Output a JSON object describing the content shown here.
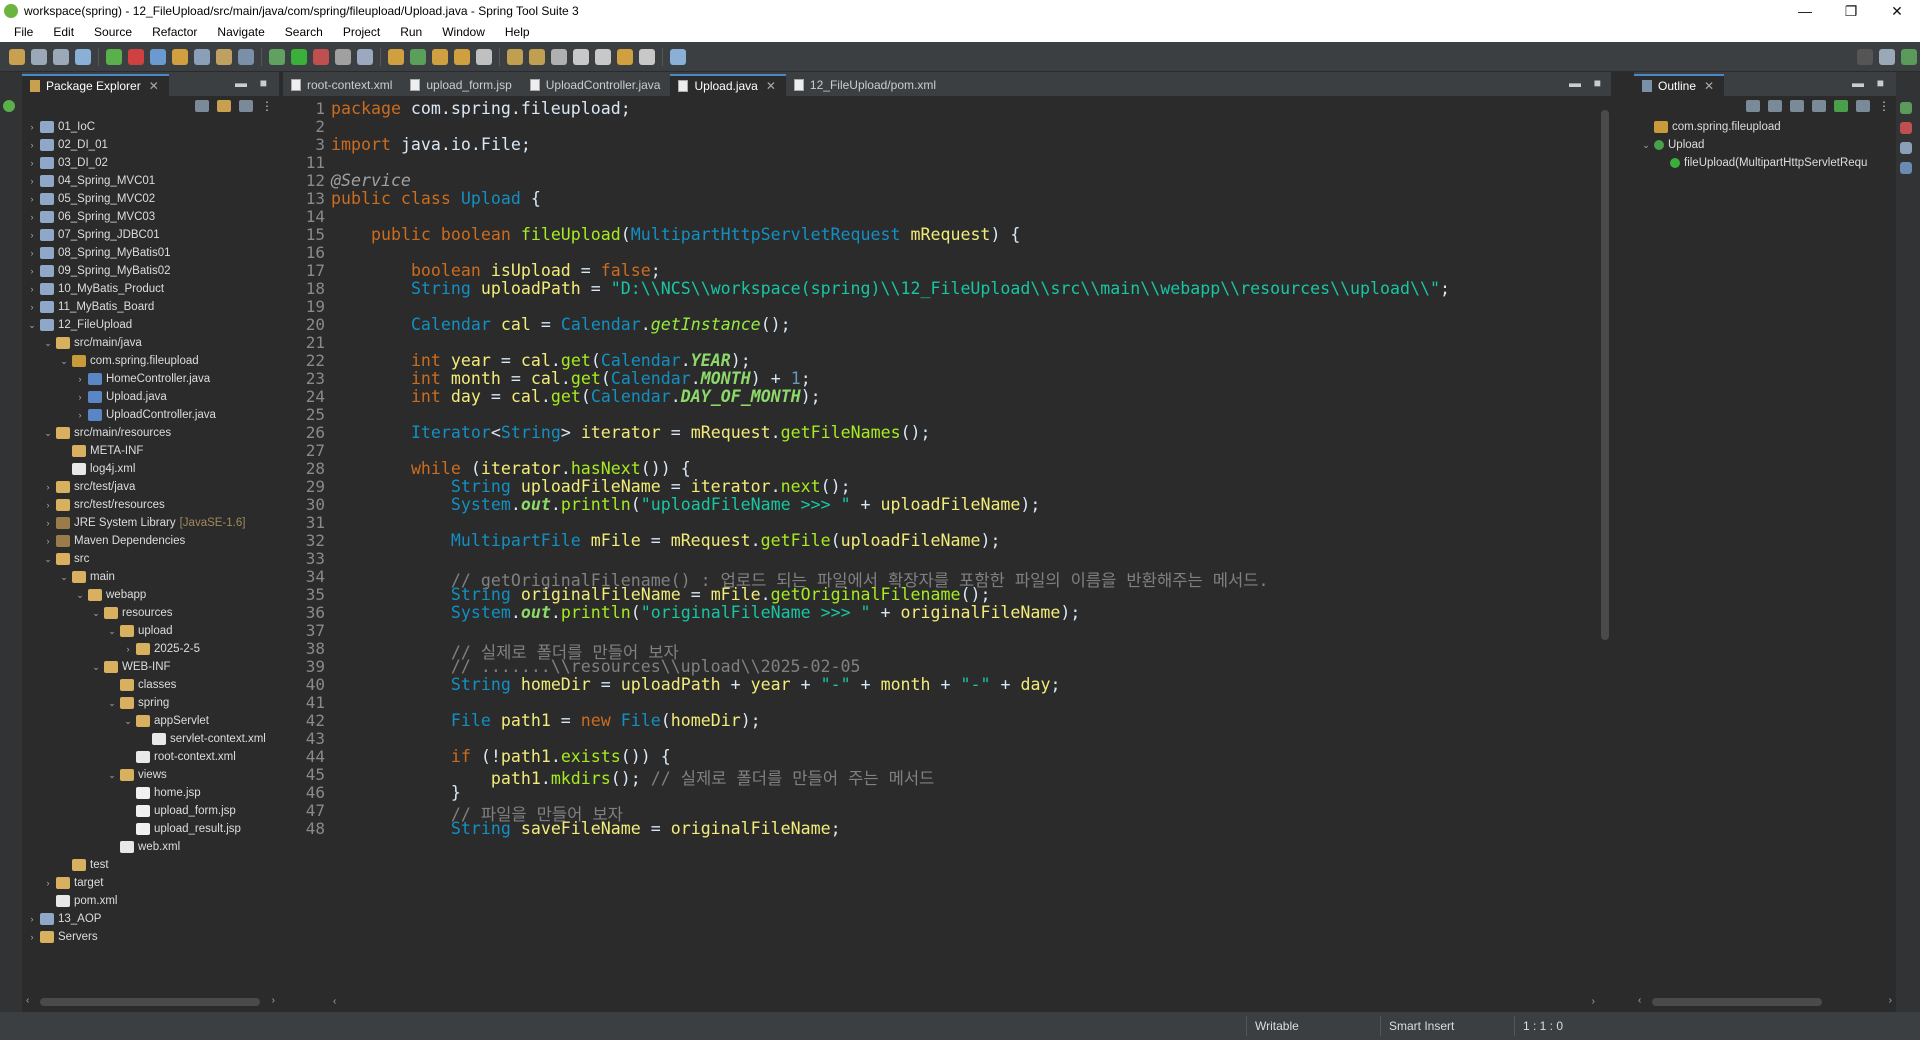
{
  "window": {
    "title": "workspace(spring) - 12_FileUpload/src/main/java/com/spring/fileupload/Upload.java - Spring Tool Suite 3"
  },
  "menu": [
    "File",
    "Edit",
    "Source",
    "Refactor",
    "Navigate",
    "Search",
    "Project",
    "Run",
    "Window",
    "Help"
  ],
  "package_explorer": {
    "title": "Package Explorer",
    "items": [
      {
        "label": "01_IoC",
        "indent": 0,
        "twisty": "›",
        "icon": "project"
      },
      {
        "label": "02_DI_01",
        "indent": 0,
        "twisty": "›",
        "icon": "project"
      },
      {
        "label": "03_DI_02",
        "indent": 0,
        "twisty": "›",
        "icon": "project"
      },
      {
        "label": "04_Spring_MVC01",
        "indent": 0,
        "twisty": "›",
        "icon": "project"
      },
      {
        "label": "05_Spring_MVC02",
        "indent": 0,
        "twisty": "›",
        "icon": "project"
      },
      {
        "label": "06_Spring_MVC03",
        "indent": 0,
        "twisty": "›",
        "icon": "project"
      },
      {
        "label": "07_Spring_JDBC01",
        "indent": 0,
        "twisty": "›",
        "icon": "project"
      },
      {
        "label": "08_Spring_MyBatis01",
        "indent": 0,
        "twisty": "›",
        "icon": "project"
      },
      {
        "label": "09_Spring_MyBatis02",
        "indent": 0,
        "twisty": "›",
        "icon": "project"
      },
      {
        "label": "10_MyBatis_Product",
        "indent": 0,
        "twisty": "›",
        "icon": "project"
      },
      {
        "label": "11_MyBatis_Board",
        "indent": 0,
        "twisty": "›",
        "icon": "project"
      },
      {
        "label": "12_FileUpload",
        "indent": 0,
        "twisty": "⌄",
        "icon": "project"
      },
      {
        "label": "src/main/java",
        "indent": 1,
        "twisty": "⌄",
        "icon": "folder"
      },
      {
        "label": "com.spring.fileupload",
        "indent": 2,
        "twisty": "⌄",
        "icon": "pkg"
      },
      {
        "label": "HomeController.java",
        "indent": 3,
        "twisty": "›",
        "icon": "java"
      },
      {
        "label": "Upload.java",
        "indent": 3,
        "twisty": "›",
        "icon": "java"
      },
      {
        "label": "UploadController.java",
        "indent": 3,
        "twisty": "›",
        "icon": "java"
      },
      {
        "label": "src/main/resources",
        "indent": 1,
        "twisty": "⌄",
        "icon": "folder"
      },
      {
        "label": "META-INF",
        "indent": 2,
        "twisty": "",
        "icon": "folder"
      },
      {
        "label": "log4j.xml",
        "indent": 2,
        "twisty": "",
        "icon": "xml"
      },
      {
        "label": "src/test/java",
        "indent": 1,
        "twisty": "›",
        "icon": "folder"
      },
      {
        "label": "src/test/resources",
        "indent": 1,
        "twisty": "›",
        "icon": "folder"
      },
      {
        "label": "JRE System Library",
        "indent": 1,
        "twisty": "›",
        "icon": "lib",
        "suffix": "[JavaSE-1.6]"
      },
      {
        "label": "Maven Dependencies",
        "indent": 1,
        "twisty": "›",
        "icon": "lib"
      },
      {
        "label": "src",
        "indent": 1,
        "twisty": "⌄",
        "icon": "folder"
      },
      {
        "label": "main",
        "indent": 2,
        "twisty": "⌄",
        "icon": "folder"
      },
      {
        "label": "webapp",
        "indent": 3,
        "twisty": "⌄",
        "icon": "folder"
      },
      {
        "label": "resources",
        "indent": 4,
        "twisty": "⌄",
        "icon": "folder"
      },
      {
        "label": "upload",
        "indent": 5,
        "twisty": "⌄",
        "icon": "folder"
      },
      {
        "label": "2025-2-5",
        "indent": 6,
        "twisty": "›",
        "icon": "folder"
      },
      {
        "label": "WEB-INF",
        "indent": 4,
        "twisty": "⌄",
        "icon": "folder"
      },
      {
        "label": "classes",
        "indent": 5,
        "twisty": "",
        "icon": "folder"
      },
      {
        "label": "spring",
        "indent": 5,
        "twisty": "⌄",
        "icon": "folder"
      },
      {
        "label": "appServlet",
        "indent": 6,
        "twisty": "⌄",
        "icon": "folder"
      },
      {
        "label": "servlet-context.xml",
        "indent": 7,
        "twisty": "",
        "icon": "xml"
      },
      {
        "label": "root-context.xml",
        "indent": 6,
        "twisty": "",
        "icon": "xml"
      },
      {
        "label": "views",
        "indent": 5,
        "twisty": "⌄",
        "icon": "folder"
      },
      {
        "label": "home.jsp",
        "indent": 6,
        "twisty": "",
        "icon": "jsp"
      },
      {
        "label": "upload_form.jsp",
        "indent": 6,
        "twisty": "",
        "icon": "jsp"
      },
      {
        "label": "upload_result.jsp",
        "indent": 6,
        "twisty": "",
        "icon": "jsp"
      },
      {
        "label": "web.xml",
        "indent": 5,
        "twisty": "",
        "icon": "xml"
      },
      {
        "label": "test",
        "indent": 2,
        "twisty": "",
        "icon": "folder"
      },
      {
        "label": "target",
        "indent": 1,
        "twisty": "›",
        "icon": "folder"
      },
      {
        "label": "pom.xml",
        "indent": 1,
        "twisty": "",
        "icon": "xml"
      },
      {
        "label": "13_AOP",
        "indent": 0,
        "twisty": "›",
        "icon": "project"
      },
      {
        "label": "Servers",
        "indent": 0,
        "twisty": "›",
        "icon": "folder"
      }
    ]
  },
  "editor_tabs": [
    {
      "label": "root-context.xml",
      "active": false
    },
    {
      "label": "upload_form.jsp",
      "active": false
    },
    {
      "label": "UploadController.java",
      "active": false
    },
    {
      "label": "Upload.java",
      "active": true
    },
    {
      "label": "12_FileUpload/pom.xml",
      "active": false
    }
  ],
  "code_lines": [
    {
      "n": "1",
      "t": "<span class=\"kw\">package</span> com.spring.fileupload;"
    },
    {
      "n": "2",
      "t": ""
    },
    {
      "n": "3",
      "t": "<span class=\"kw\">import</span> java.io.File;"
    },
    {
      "n": "11",
      "t": ""
    },
    {
      "n": "12",
      "t": "<span class=\"an\">@Service</span>"
    },
    {
      "n": "13",
      "t": "<span class=\"kw\">public class</span> <span class=\"ty\">Upload</span> {"
    },
    {
      "n": "14",
      "t": ""
    },
    {
      "n": "15",
      "t": "    <span class=\"kw\">public boolean</span> <span class=\"fn\">fileUpload</span>(<span class=\"ty\">MultipartHttpServletRequest</span> <span class=\"var\">mRequest</span>) {"
    },
    {
      "n": "16",
      "t": ""
    },
    {
      "n": "17",
      "t": "        <span class=\"kw\">boolean</span> <span class=\"var\">isUpload</span> = <span class=\"kw\">false</span>;"
    },
    {
      "n": "18",
      "t": "        <span class=\"ty\">String</span> <span class=\"var\">uploadPath</span> = <span class=\"str\">\"D:\\\\NCS\\\\workspace(spring)\\\\12_FileUpload\\\\src\\\\main\\\\webapp\\\\resources\\\\upload\\\\\"</span>;"
    },
    {
      "n": "19",
      "t": ""
    },
    {
      "n": "20",
      "t": "        <span class=\"ty\">Calendar</span> <span class=\"var\">cal</span> = <span class=\"ty\">Calendar</span>.<span class=\"sm\">getInstance</span>();"
    },
    {
      "n": "21",
      "t": ""
    },
    {
      "n": "22",
      "t": "        <span class=\"kw\">int</span> <span class=\"var\">year</span> = <span class=\"var\">cal</span>.<span class=\"fn\">get</span>(<span class=\"ty\">Calendar</span>.<span class=\"fl\">YEAR</span>);"
    },
    {
      "n": "23",
      "t": "        <span class=\"kw\">int</span> <span class=\"var\">month</span> = <span class=\"var\">cal</span>.<span class=\"fn\">get</span>(<span class=\"ty\">Calendar</span>.<span class=\"fl\">MONTH</span>) + <span class=\"num\">1</span>;"
    },
    {
      "n": "24",
      "t": "        <span class=\"kw\">int</span> <span class=\"var\">day</span> = <span class=\"var\">cal</span>.<span class=\"fn\">get</span>(<span class=\"ty\">Calendar</span>.<span class=\"fl\">DAY_OF_MONTH</span>);"
    },
    {
      "n": "25",
      "t": ""
    },
    {
      "n": "26",
      "t": "        <span class=\"ty\">Iterator</span>&lt;<span class=\"ty\">String</span>&gt; <span class=\"var\">iterator</span> = <span class=\"var\">mRequest</span>.<span class=\"fn\">getFileNames</span>();"
    },
    {
      "n": "27",
      "t": ""
    },
    {
      "n": "28",
      "t": "        <span class=\"kw\">while</span> (<span class=\"var\">iterator</span>.<span class=\"fn\">hasNext</span>()) {"
    },
    {
      "n": "29",
      "t": "            <span class=\"ty\">String</span> <span class=\"var\">uploadFileName</span> = <span class=\"var\">iterator</span>.<span class=\"fn\">next</span>();"
    },
    {
      "n": "30",
      "t": "            <span class=\"ty\">System</span>.<span class=\"fl\">out</span>.<span class=\"fn\">println</span>(<span class=\"str\">\"uploadFileName &gt;&gt;&gt; \"</span> + <span class=\"var\">uploadFileName</span>);"
    },
    {
      "n": "31",
      "t": ""
    },
    {
      "n": "32",
      "t": "            <span class=\"ty\">MultipartFile</span> <span class=\"var\">mFile</span> = <span class=\"var\">mRequest</span>.<span class=\"fn\">getFile</span>(<span class=\"var\">uploadFileName</span>);"
    },
    {
      "n": "33",
      "t": ""
    },
    {
      "n": "34",
      "t": "            <span class=\"cm\">// getOriginalFilename() : 업로드 되는 파일에서 확장자를 포함한 파일의 이름을 반환해주는 메서드.</span>"
    },
    {
      "n": "35",
      "t": "            <span class=\"ty\">String</span> <span class=\"var\">originalFileName</span> = <span class=\"var\">mFile</span>.<span class=\"fn\">getOriginalFilename</span>();"
    },
    {
      "n": "36",
      "t": "            <span class=\"ty\">System</span>.<span class=\"fl\">out</span>.<span class=\"fn\">println</span>(<span class=\"str\">\"originalFileName &gt;&gt;&gt; \"</span> + <span class=\"var\">originalFileName</span>);"
    },
    {
      "n": "37",
      "t": ""
    },
    {
      "n": "38",
      "t": "            <span class=\"cm\">// 실제로 폴더를 만들어 보자</span>"
    },
    {
      "n": "39",
      "t": "            <span class=\"cm\">// .......\\\\resources\\\\upload\\\\2025-02-05</span>"
    },
    {
      "n": "40",
      "t": "            <span class=\"ty\">String</span> <span class=\"var\">homeDir</span> = <span class=\"var\">uploadPath</span> + <span class=\"var\">year</span> + <span class=\"str\">\"-\"</span> + <span class=\"var\">month</span> + <span class=\"str\">\"-\"</span> + <span class=\"var\">day</span>;"
    },
    {
      "n": "41",
      "t": ""
    },
    {
      "n": "42",
      "t": "            <span class=\"ty\">File</span> <span class=\"var\">path1</span> = <span class=\"kw\">new</span> <span class=\"ty\">File</span>(<span class=\"var\">homeDir</span>);"
    },
    {
      "n": "43",
      "t": ""
    },
    {
      "n": "44",
      "t": "            <span class=\"kw\">if</span> (!<span class=\"var\">path1</span>.<span class=\"fn\">exists</span>()) {"
    },
    {
      "n": "45",
      "t": "                <span class=\"var\">path1</span>.<span class=\"fn\">mkdirs</span>(); <span class=\"cm\">// 실제로 폴더를 만들어 주는 메서드</span>"
    },
    {
      "n": "46",
      "t": "            }"
    },
    {
      "n": "47",
      "t": "            <span class=\"cm\">// 파일을 만들어 보자</span>"
    },
    {
      "n": "48",
      "t": "            <span class=\"ty\">String</span> <span class=\"var\">saveFileName</span> = <span class=\"var\">originalFileName</span>;"
    }
  ],
  "outline": {
    "title": "Outline",
    "items": [
      {
        "label": "com.spring.fileupload",
        "indent": 0,
        "twisty": ""
      },
      {
        "label": "Upload",
        "indent": 0,
        "twisty": "⌄"
      },
      {
        "label": "fileUpload(MultipartHttpServletRequ",
        "indent": 1,
        "twisty": ""
      }
    ]
  },
  "status": {
    "writable": "Writable",
    "insert_mode": "Smart Insert",
    "position": "1 : 1 : 0"
  },
  "colors": {
    "background": "#2b2b2b",
    "panel": "#3c3f41",
    "keyword": "#cc6c1d",
    "type": "#1290c3",
    "string": "#17c6a3",
    "comment": "#808080"
  }
}
